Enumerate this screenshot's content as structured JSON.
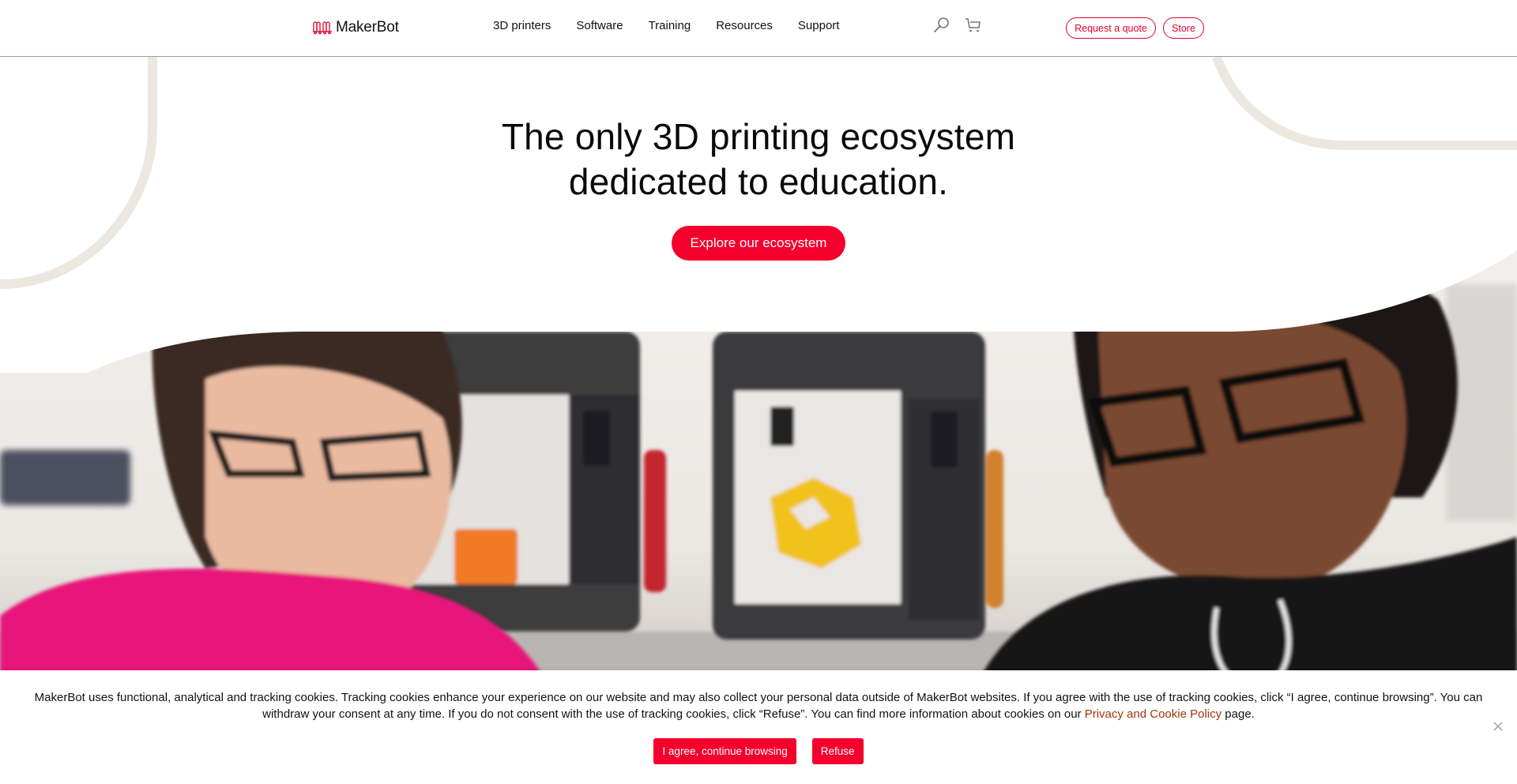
{
  "brand": {
    "name": "MakerBot",
    "accent_color": "#f4002d",
    "outline_color": "#e4002b",
    "deco_color": "#ece8e0"
  },
  "header": {
    "nav": [
      {
        "label": "3D printers"
      },
      {
        "label": "Software"
      },
      {
        "label": "Training"
      },
      {
        "label": "Resources"
      },
      {
        "label": "Support"
      }
    ],
    "icons": [
      "search-icon",
      "cart-icon"
    ],
    "request_quote_label": "Request a quote",
    "store_label": "Store"
  },
  "hero": {
    "title_line1": "The only 3D printing ecosystem",
    "title_line2": "dedicated to education.",
    "cta_label": "Explore our ecosystem",
    "image_description": "Two students wearing glasses working in front of MakerBot 3D printers, one printing a yellow geometric object"
  },
  "cookie_banner": {
    "text_before_link": "MakerBot uses functional, analytical and tracking cookies. Tracking cookies enhance your experience on our website and may also collect your personal data outside of MakerBot websites. If you agree with the use of tracking cookies, click “I agree, continue browsing”. You can withdraw your consent at any time. If you do not consent with the use of tracking cookies, click “Refuse”. You can find more information about cookies on our ",
    "link_label": "Privacy and Cookie Policy",
    "text_after_link": " page.",
    "agree_label": "I agree, continue browsing",
    "refuse_label": "Refuse",
    "close_icon": "close-icon"
  }
}
